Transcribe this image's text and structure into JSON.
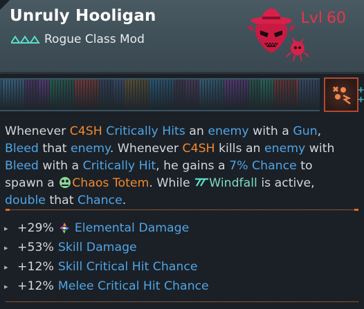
{
  "item": {
    "name": "Unruly Hooligan",
    "type": "Rogue Class Mod",
    "level_prefix": "Lvl",
    "level": "60",
    "rarity_color": "#e8344a"
  },
  "description": {
    "p1": "Whenever ",
    "k_c4sh_1": "C4SH",
    "p2": " ",
    "k_crit_hits": "Critically Hits",
    "p3": " an ",
    "k_enemy_1": "enemy",
    "p4": " with a ",
    "k_gun": "Gun",
    "p5": ",",
    "k_bleed_1": "Bleed",
    "p6": " that ",
    "k_enemy_2": "enemy",
    "p7": ". Whenever ",
    "k_c4sh_2": "C4SH",
    "p8": " kills an ",
    "k_enemy_3": "enemy",
    "p9": " with",
    "k_bleed_2": "Bleed",
    "p10": " with a ",
    "k_crit_hit": "Critically Hit",
    "p11": ", he gains a ",
    "k_chance_pct": "7% Chance",
    "p12": " to",
    "p13": "spawn a ",
    "k_totem": "Chaos Totem",
    "p14": ". While ",
    "k_windfall": "Windfall",
    "p15": " is active,",
    "k_double": "double",
    "p16": " that ",
    "k_chance": "Chance",
    "p17": "."
  },
  "stats": [
    {
      "value": "+29%",
      "name": "Elemental Damage",
      "icon": "elemental-icon"
    },
    {
      "value": "+53%",
      "name": "Skill Damage",
      "icon": ""
    },
    {
      "value": "+12%",
      "name": "Skill Critical Hit Chance",
      "icon": ""
    },
    {
      "value": "+12%",
      "name": "Melee Critical Hit Chance",
      "icon": ""
    }
  ],
  "colors": {
    "keyword": "#4fa5e6",
    "character": "#f2892d",
    "header_bg": "#45555d",
    "body_bg": "#1b2026"
  }
}
